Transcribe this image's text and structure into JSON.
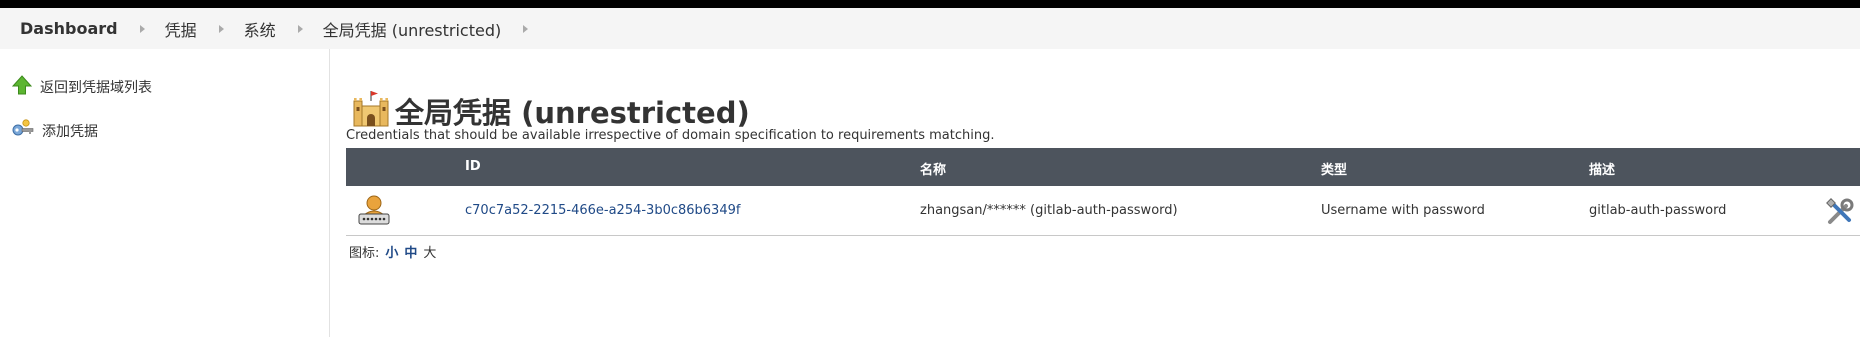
{
  "breadcrumb": {
    "items": [
      "Dashboard",
      "凭据",
      "系统",
      "全局凭据 (unrestricted)"
    ]
  },
  "sidebar": {
    "tasks": [
      {
        "label": "返回到凭据域列表",
        "icon": "up-arrow-icon"
      },
      {
        "label": "添加凭据",
        "icon": "key-icon"
      }
    ]
  },
  "main": {
    "title": "全局凭据 (unrestricted)",
    "title_icon": "castle-icon",
    "description": "Credentials that should be available irrespective of domain specification to requirements matching."
  },
  "table": {
    "headers": [
      "ID",
      "名称",
      "类型",
      "描述"
    ],
    "rows": [
      {
        "icon": "user-password-icon",
        "id": "c70c7a52-2215-466e-a254-3b0c86b6349f",
        "name": "zhangsan/****** (gitlab-auth-password)",
        "type": "Username with password",
        "description": "gitlab-auth-password",
        "action_icon": "configure-tools-icon"
      }
    ]
  },
  "icon_sizes": {
    "label": "图标:",
    "options": [
      "小",
      "中",
      "大"
    ],
    "selected": "大"
  },
  "colors": {
    "header_bg": "#4d545d",
    "link": "#204a87",
    "breadcrumb_bg": "#f5f5f5"
  }
}
